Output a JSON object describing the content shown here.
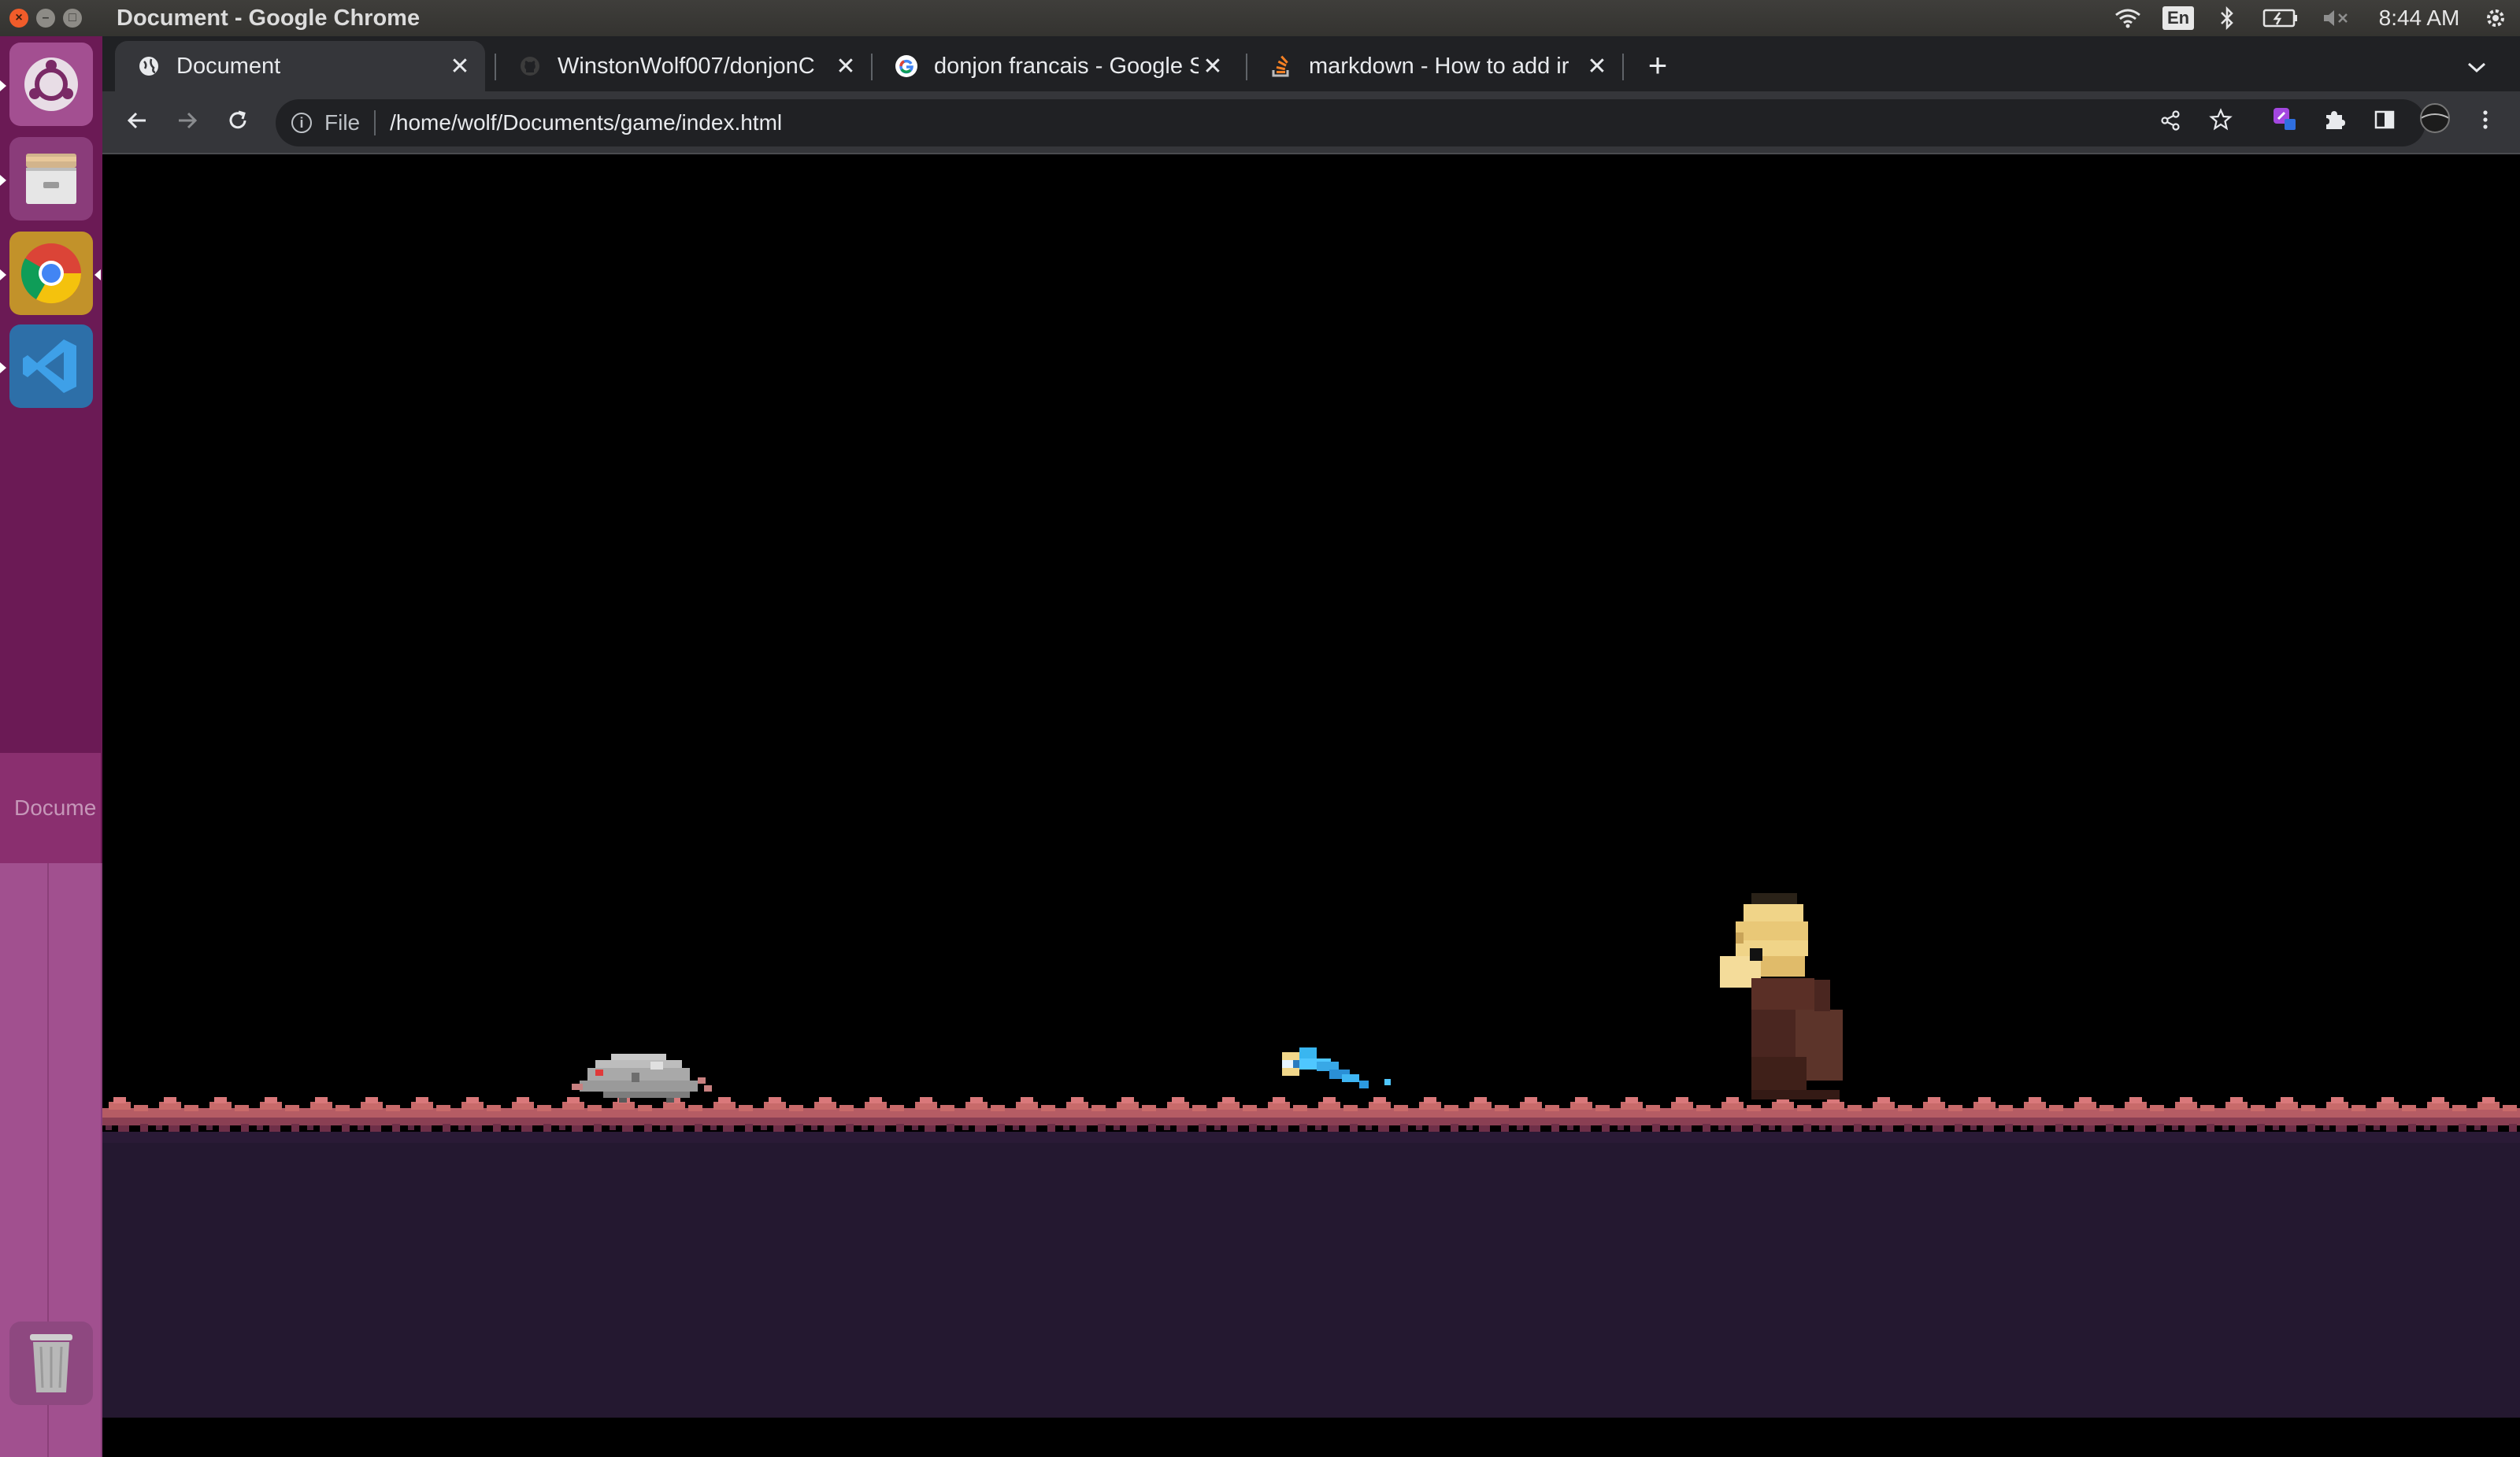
{
  "system_bar": {
    "window_title": "Document - Google Chrome",
    "language": "En",
    "clock": "8:44 AM"
  },
  "launcher": {
    "items": [
      "Ubuntu Dash",
      "Files",
      "Google Chrome",
      "Visual Studio Code"
    ],
    "hover_label": "Docume",
    "trash": "Trash"
  },
  "browser": {
    "tabs": [
      {
        "label": "Document",
        "active": true,
        "icon": "globe-icon"
      },
      {
        "label": "WinstonWolf007/donjonC",
        "active": false,
        "icon": "github-icon"
      },
      {
        "label": "donjon francais - Google S",
        "active": false,
        "icon": "google-icon"
      },
      {
        "label": "markdown - How to add ir",
        "active": false,
        "icon": "stackoverflow-icon"
      }
    ],
    "new_tab": "+",
    "address": {
      "scheme_label": "File",
      "url": "/home/wolf/Documents/game/index.html"
    }
  },
  "game": {
    "background": "#000000",
    "ground_color": "#241830",
    "ground_top_color": "#c86a6a",
    "entities": [
      "grey-rat-sprite",
      "blue-spirit-sprite",
      "hooded-hero-sprite"
    ]
  }
}
